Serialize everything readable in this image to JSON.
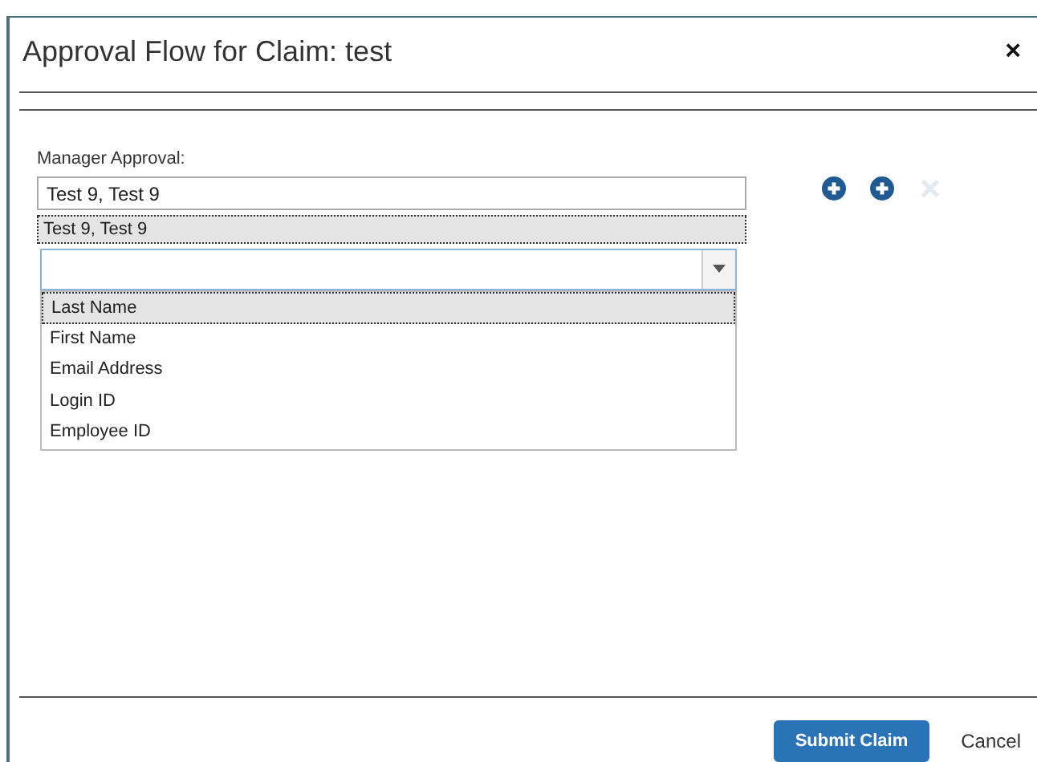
{
  "dialog": {
    "title": "Approval Flow for Claim: test",
    "close": "×"
  },
  "manager": {
    "label": "Manager Approval:",
    "value": "Test 9, Test 9",
    "results": [
      {
        "label": "Test 9, Test 9",
        "selected": true
      }
    ],
    "search_by": [
      {
        "label": "Last Name",
        "selected": true
      },
      {
        "label": "First Name",
        "selected": false
      },
      {
        "label": "Email Address",
        "selected": false
      },
      {
        "label": "Login ID",
        "selected": false
      },
      {
        "label": "Employee ID",
        "selected": false
      }
    ]
  },
  "actions": [
    {
      "kind": "add",
      "disabled": false
    },
    {
      "kind": "add",
      "disabled": false
    },
    {
      "kind": "remove",
      "disabled": true
    }
  ],
  "buttons": [
    {
      "label": "Submit Claim",
      "kind": "primary"
    },
    {
      "label": "Cancel",
      "kind": "link"
    }
  ]
}
